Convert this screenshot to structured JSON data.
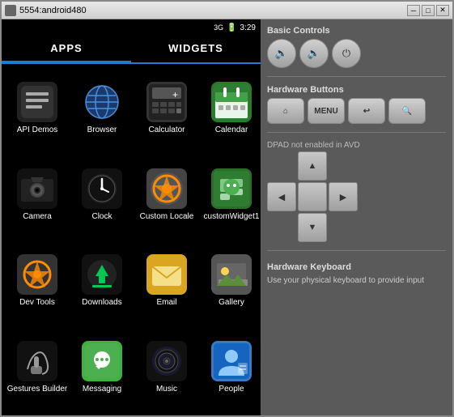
{
  "window": {
    "title": "5554:android480",
    "min_label": "─",
    "max_label": "□",
    "close_label": "✕"
  },
  "status_bar": {
    "signal": "3G",
    "battery": "🔋",
    "time": "3:29"
  },
  "tabs": [
    {
      "id": "apps",
      "label": "APPS",
      "active": true
    },
    {
      "id": "widgets",
      "label": "WIDGETS",
      "active": false
    }
  ],
  "apps": [
    {
      "id": "api-demos",
      "label": "API Demos"
    },
    {
      "id": "browser",
      "label": "Browser"
    },
    {
      "id": "calculator",
      "label": "Calculator"
    },
    {
      "id": "calendar",
      "label": "Calendar"
    },
    {
      "id": "camera",
      "label": "Camera"
    },
    {
      "id": "clock",
      "label": "Clock"
    },
    {
      "id": "custom-locale",
      "label": "Custom Locale"
    },
    {
      "id": "custom-widget",
      "label": "customWidget1"
    },
    {
      "id": "dev-tools",
      "label": "Dev Tools"
    },
    {
      "id": "downloads",
      "label": "Downloads"
    },
    {
      "id": "email",
      "label": "Email"
    },
    {
      "id": "gallery",
      "label": "Gallery"
    },
    {
      "id": "gestures",
      "label": "Gestures Builder"
    },
    {
      "id": "messaging",
      "label": "Messaging"
    },
    {
      "id": "music",
      "label": "Music"
    },
    {
      "id": "people",
      "label": "People"
    }
  ],
  "right_panel": {
    "basic_controls_label": "Basic Controls",
    "hardware_buttons_label": "Hardware Buttons",
    "dpad_label": "DPAD not enabled in AVD",
    "keyboard_label": "Hardware Keyboard",
    "keyboard_desc": "Use your physical keyboard to provide input",
    "menu_label": "MENU",
    "volume_down": "🔈",
    "volume_up": "🔉",
    "power": "⏻",
    "home": "⌂",
    "back": "↩",
    "search": "🔍"
  }
}
